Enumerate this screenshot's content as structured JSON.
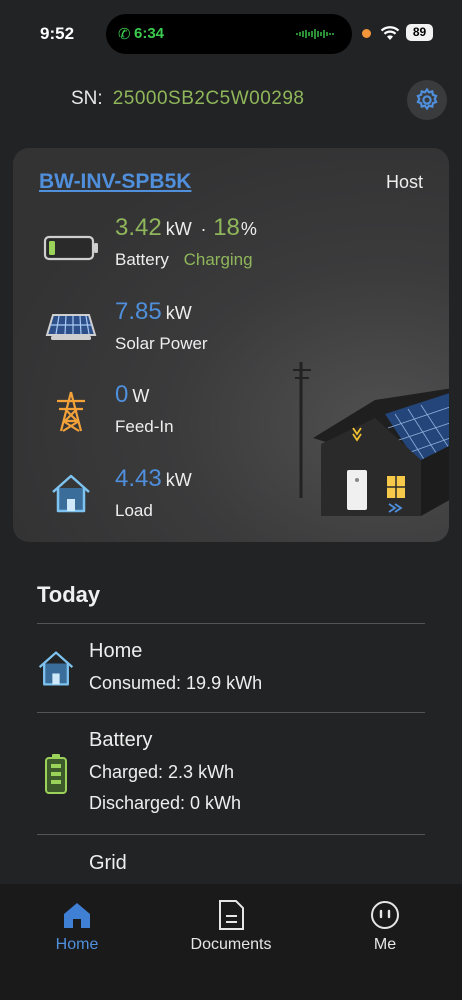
{
  "status_bar": {
    "time": "9:52",
    "call_time": "6:34",
    "battery": "89"
  },
  "header": {
    "sn_label": "SN:",
    "sn_value": "25000SB2C5W00298"
  },
  "device": {
    "name": "BW-INV-SPB5K",
    "role": "Host",
    "battery": {
      "power": "3.42",
      "unit": "kW",
      "separator": "·",
      "soc": "18",
      "soc_unit": "%",
      "label": "Battery",
      "status": "Charging"
    },
    "solar": {
      "power": "7.85",
      "unit": "kW",
      "label": "Solar Power"
    },
    "grid": {
      "power": "0",
      "unit": "W",
      "label": "Feed-In"
    },
    "load": {
      "power": "4.43",
      "unit": "kW",
      "label": "Load"
    }
  },
  "today": {
    "title": "Today",
    "home": {
      "title": "Home",
      "consumed": "Consumed: 19.9 kWh"
    },
    "battery": {
      "title": "Battery",
      "charged": "Charged: 2.3 kWh",
      "discharged": "Discharged: 0 kWh"
    },
    "grid": {
      "title": "Grid"
    }
  },
  "tabs": [
    {
      "label": "Home",
      "icon": "home-icon",
      "active": true
    },
    {
      "label": "Documents",
      "icon": "document-icon",
      "active": false
    },
    {
      "label": "Me",
      "icon": "profile-icon",
      "active": false
    }
  ],
  "colors": {
    "accent_blue": "#4f8fdc",
    "accent_green": "#8fb65a",
    "background": "#222324"
  }
}
